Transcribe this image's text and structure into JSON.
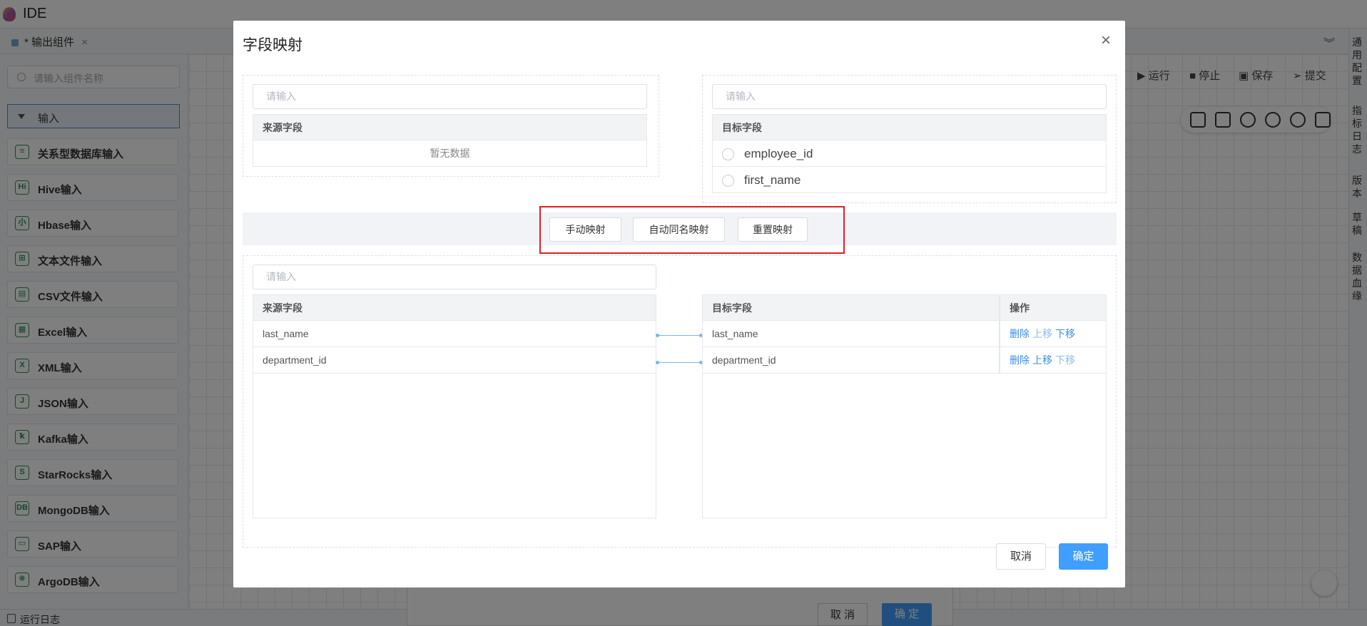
{
  "app": {
    "title": "IDE"
  },
  "tab": {
    "label": "* 输出组件",
    "close": "×"
  },
  "sidebar": {
    "search_placeholder": "请输入组件名称",
    "group_label": "输入",
    "items": [
      {
        "label": "关系型数据库输入",
        "icon": "≡"
      },
      {
        "label": "Hive输入",
        "icon": "Hi"
      },
      {
        "label": "Hbase输入",
        "icon": "小"
      },
      {
        "label": "文本文件输入",
        "icon": "⊞"
      },
      {
        "label": "CSV文件输入",
        "icon": "▤"
      },
      {
        "label": "Excel输入",
        "icon": "▦"
      },
      {
        "label": "XML输入",
        "icon": "X"
      },
      {
        "label": "JSON输入",
        "icon": "J"
      },
      {
        "label": "Kafka输入",
        "icon": "ꝁ"
      },
      {
        "label": "StarRocks输入",
        "icon": "S"
      },
      {
        "label": "MongoDB输入",
        "icon": "DB"
      },
      {
        "label": "SAP输入",
        "icon": "▭"
      },
      {
        "label": "ArgoDB输入",
        "icon": "❋"
      }
    ]
  },
  "toolbar": {
    "run": "运行",
    "stop": "停止",
    "save": "保存",
    "submit": "提交"
  },
  "rightbar": {
    "items": [
      "通用配置",
      "指标日志",
      "版本",
      "草稿",
      "数据血缘"
    ]
  },
  "statusbar": {
    "log": "运行日志"
  },
  "bg_footer": {
    "cancel": "取 消",
    "confirm": "确 定"
  },
  "modal": {
    "title": "字段映射",
    "close": "×",
    "source_top": {
      "placeholder": "请输入",
      "header": "来源字段",
      "empty": "暂无数据"
    },
    "target_top": {
      "placeholder": "请输入",
      "header": "目标字段",
      "rows": [
        "employee_id",
        "first_name"
      ]
    },
    "actions": {
      "manual": "手动映射",
      "auto": "自动同名映射",
      "reset": "重置映射"
    },
    "mapping": {
      "placeholder": "请输入",
      "source_header": "来源字段",
      "target_header": "目标字段",
      "op_header": "操作",
      "source_rows": [
        "last_name",
        "department_id"
      ],
      "target_rows": [
        "last_name",
        "department_id"
      ],
      "ops": {
        "delete": "删除",
        "up": "上移",
        "down": "下移"
      }
    },
    "footer": {
      "cancel": "取消",
      "confirm": "确定"
    }
  },
  "colors": {
    "accent": "#409eff",
    "highlight": "#e02020",
    "link": "#3c8ce6"
  }
}
